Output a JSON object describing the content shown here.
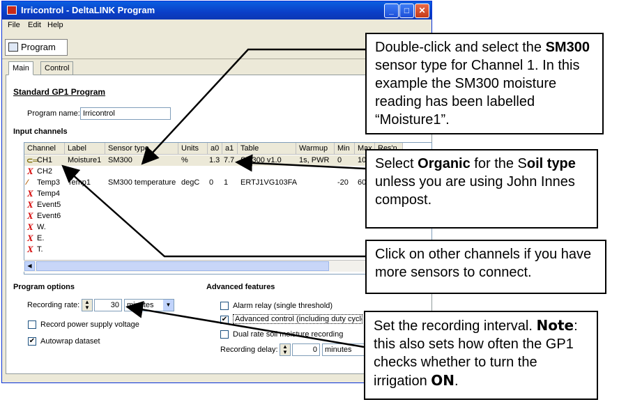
{
  "window": {
    "title": "Irricontrol - DeltaLINK Program",
    "menu": [
      "File",
      "Edit",
      "Help"
    ],
    "toolbar_label": "Program",
    "tabs": [
      "Main",
      "Control"
    ]
  },
  "main": {
    "heading": "Standard GP1 Program",
    "program_name_label": "Program name:",
    "program_name_value": "Irricontrol",
    "input_channels_label": "Input channels",
    "columns": [
      "Channel",
      "Label",
      "Sensor type",
      "Units",
      "a0",
      "a1",
      "Table",
      "Warmup",
      "Min",
      "Max",
      "Res'n"
    ],
    "rows": [
      {
        "channel": "CH1",
        "label": "Moisture1",
        "sensor": "SM300",
        "units": "%",
        "a0": "1.3",
        "a1": "7.7",
        "table": "SM300 v1.0",
        "warmup": "1s, PWR",
        "min": "0",
        "max": "10",
        "icon": "sensor-plug-icon"
      },
      {
        "channel": "CH2",
        "icon": "disabled-x-icon"
      },
      {
        "channel": "Temp3",
        "label": "Temp1",
        "sensor": "SM300 temperature",
        "units": "degC",
        "a0": "0",
        "a1": "1",
        "table": "ERTJ1VG103FA",
        "min": "-20",
        "max": "60",
        "icon": "thermometer-icon"
      },
      {
        "channel": "Temp4",
        "icon": "disabled-x-icon"
      },
      {
        "channel": "Event5",
        "icon": "disabled-x-icon"
      },
      {
        "channel": "Event6",
        "icon": "disabled-x-icon"
      },
      {
        "channel": "W.",
        "icon": "disabled-x-icon"
      },
      {
        "channel": "E.",
        "icon": "disabled-x-icon"
      },
      {
        "channel": "T.",
        "icon": "disabled-x-icon"
      }
    ]
  },
  "program_options": {
    "heading": "Program options",
    "recording_rate_label": "Recording rate:",
    "recording_rate_value": "30",
    "recording_rate_unit": "minutes",
    "record_power_label": "Record power supply voltage",
    "record_power_checked": false,
    "autowrap_label": "Autowrap dataset",
    "autowrap_checked": true
  },
  "advanced": {
    "heading": "Advanced features",
    "alarm_label": "Alarm relay (single threshold)",
    "alarm_checked": false,
    "advanced_control_label": "Advanced control (including duty cycle op",
    "advanced_control_checked": true,
    "dual_rate_label": "Dual rate soil moisture recording",
    "dual_rate_checked": false,
    "recording_delay_label": "Recording delay:",
    "recording_delay_value": "0",
    "recording_delay_unit": "minutes"
  },
  "callouts": {
    "c1_pre": "Double-click and select the ",
    "c1_bold": "SM300",
    "c1_post": " sensor type for Channel 1. In this example the SM300 moisture reading has been labelled “Moisture1”.",
    "c2_pre": "Select ",
    "c2_bold1": "Organic",
    "c2_mid1": " for the S",
    "c2_bold2": "oil type",
    "c2_post": " unless you are using John Innes compost.",
    "c3_text": "Click on other channels if you have more sensors to connect.",
    "c4_pre": "Set the recording interval. ",
    "c4_note": "Note",
    "c4_mid": ": this also sets how often the GP1 checks whether to turn the irrigation ",
    "c4_on": "ON",
    "c4_end": "."
  }
}
